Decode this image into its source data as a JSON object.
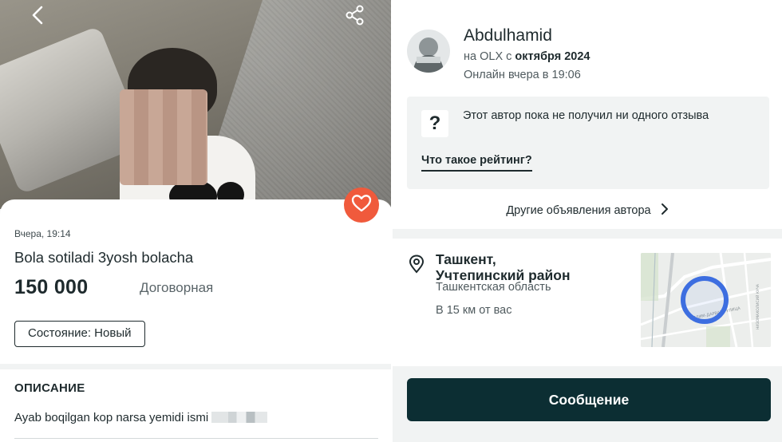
{
  "listing": {
    "posted": "Вчера, 19:14",
    "title": "Bola sotiladi 3yosh bolacha",
    "price": "150 000",
    "negotiable": "Договорная",
    "condition": "Состояние: Новый",
    "description_heading": "ОПИСАНИЕ",
    "description_text": "Ayab boqilgan kop narsa yemidi ismi"
  },
  "seller": {
    "name": "Abdulhamid",
    "since_prefix": "на OLX с ",
    "since_date": "октября 2024",
    "last_online": "Онлайн вчера в 19:06",
    "rating_icon": "?",
    "rating_text": "Этот автор пока не получил ни одного отзыва",
    "rating_link": "Что такое рейтинг?",
    "other_ads": "Другие объявления автора"
  },
  "location": {
    "city_line1": "Ташкент,",
    "city_line2": "Учтепинский район",
    "region": "Ташкентская область",
    "distance": "В 15 км от вас",
    "map_street": "ИЛЛИМ-ДАРВАЗА УЛИЦА",
    "map_street2": "НИЗОМАХОЛИСИЙ КУЧА"
  },
  "actions": {
    "message": "Сообщение"
  },
  "colors": {
    "brand_dark": "#0c2e33",
    "favorite": "#f05a3c",
    "map_marker": "#3d6ee0"
  },
  "icons": {
    "back": "back-arrow-icon",
    "share": "share-icon",
    "favorite": "heart-icon",
    "pin": "location-pin-icon",
    "chevron": "chevron-right-icon"
  }
}
